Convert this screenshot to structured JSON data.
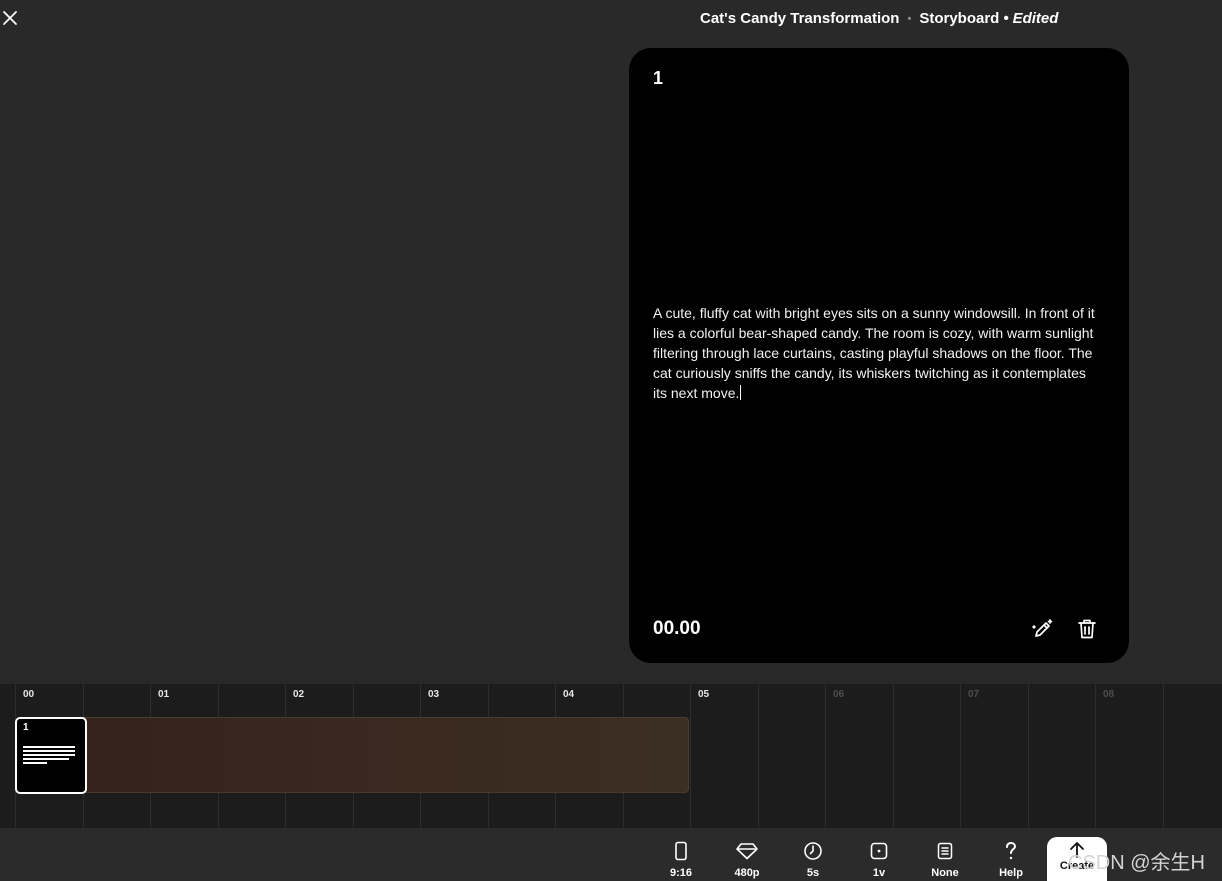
{
  "header": {
    "project_title": "Cat's Candy Transformation",
    "view": "Storyboard",
    "status": "Edited",
    "separator": "•"
  },
  "card": {
    "number": "1",
    "description": "A cute, fluffy cat with bright eyes sits on a sunny windowsill. In front of it lies a colorful bear-shaped candy. The room is cozy, with warm sunlight filtering through lace curtains, casting playful shadows on the floor. The cat curiously sniffs the candy, its whiskers twitching as it contemplates its next move.",
    "time": "00.00"
  },
  "timeline": {
    "ticks": [
      "00",
      "01",
      "02",
      "03",
      "04",
      "05",
      "06",
      "07",
      "08"
    ],
    "clip_number": "1"
  },
  "toolbar": {
    "items": [
      {
        "label": "9:16",
        "icon": "phone-aspect-icon"
      },
      {
        "label": "480p",
        "icon": "diamond-icon"
      },
      {
        "label": "5s",
        "icon": "clock-icon"
      },
      {
        "label": "1v",
        "icon": "variation-icon"
      },
      {
        "label": "None",
        "icon": "preset-icon"
      },
      {
        "label": "Help",
        "icon": "question-icon"
      }
    ],
    "create_label": "Create"
  },
  "watermark": "CSDN @余生H"
}
